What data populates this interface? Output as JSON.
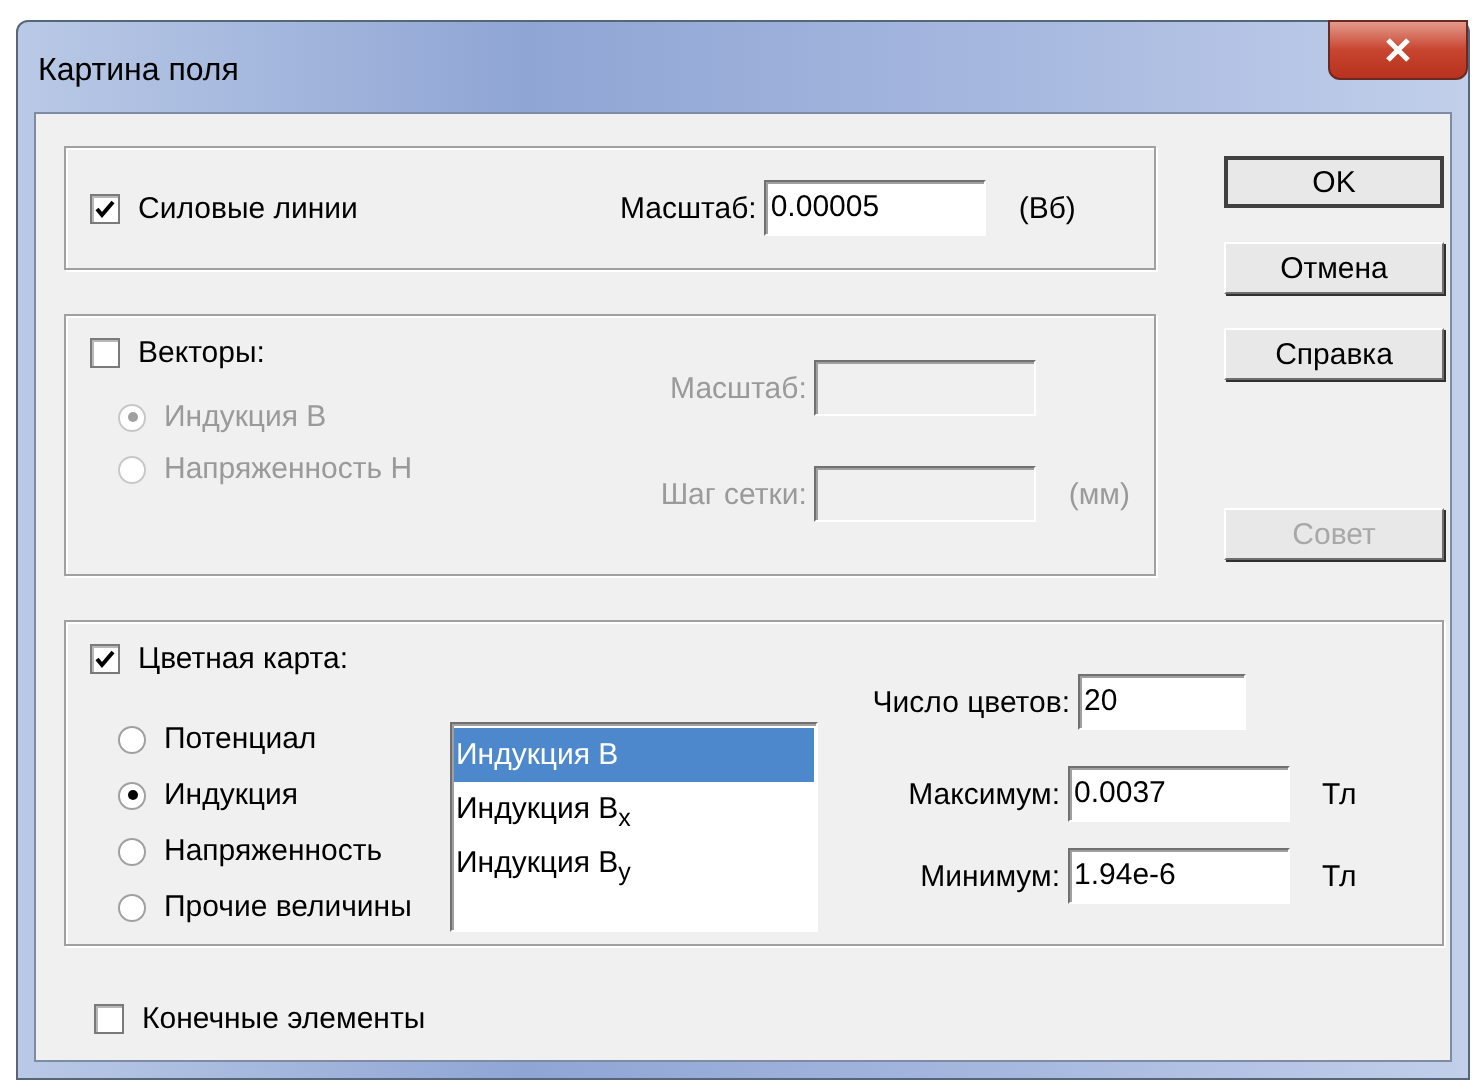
{
  "window": {
    "title": "Картина поля"
  },
  "field_lines": {
    "label": "Силовые линии",
    "checked": true,
    "scale_label": "Масштаб:",
    "scale_value": "0.00005",
    "unit": "(Вб)"
  },
  "vectors": {
    "label": "Векторы:",
    "checked": false,
    "disabled": true,
    "options": [
      {
        "label": "Индукция B",
        "selected": true
      },
      {
        "label": "Напряженность H",
        "selected": false
      }
    ],
    "scale_label": "Масштаб:",
    "grid_label": "Шаг сетки:",
    "grid_unit": "(мм)"
  },
  "color_map": {
    "label": "Цветная карта:",
    "checked": true,
    "options": [
      {
        "label": "Потенциал",
        "selected": false
      },
      {
        "label": "Индукция",
        "selected": true
      },
      {
        "label": "Напряженность",
        "selected": false
      },
      {
        "label": "Прочие величины",
        "selected": false
      }
    ],
    "list": [
      {
        "label": "Индукция B",
        "selected": true
      },
      {
        "label": "Индукция B$_{x}$",
        "selected": false
      },
      {
        "label": "Индукция B$_{y}$",
        "selected": false
      }
    ],
    "colors_label": "Число цветов:",
    "colors_value": "20",
    "max_label": "Максимум:",
    "max_value": "0.0037",
    "max_unit": "Тл",
    "min_label": "Минимум:",
    "min_value": "1.94e-6",
    "min_unit": "Тл"
  },
  "finite_elements": {
    "label": "Конечные элементы",
    "checked": false
  },
  "buttons": [
    {
      "label": "OK",
      "default": true,
      "disabled": false
    },
    {
      "label": "Отмена",
      "default": false,
      "disabled": false
    },
    {
      "label": "Справка",
      "default": false,
      "disabled": false
    },
    {
      "label": "Совет",
      "default": false,
      "disabled": true
    }
  ]
}
